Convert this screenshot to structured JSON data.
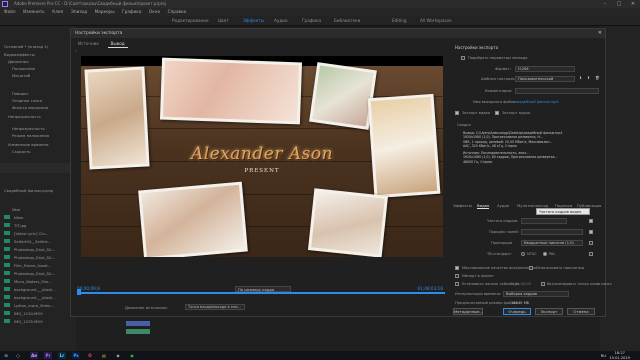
{
  "app": {
    "title": "Adobe Premiere Pro CC - D:\\Сайт\\заказы\\Свадебный фильм\\проект.prproj",
    "menu": [
      "Файл",
      "Изменить",
      "Клип",
      "Эпизод",
      "Маркеры",
      "Графика",
      "Окно",
      "Справка"
    ],
    "workspaces": [
      "Редактирование",
      "Цвет",
      "Эффекты",
      "Аудио",
      "Графика",
      "Библиотеки",
      "Editing",
      "All Workspaces"
    ],
    "active_workspace": "Эффекты"
  },
  "left_panel": {
    "source": "Основной * (эпизод 1)",
    "items": [
      "Видеоэффекты",
      "Движение",
      "Положение",
      "Масштаб",
      "Поворот",
      "Опорная точка",
      "Фильтр мерцания",
      "Непрозрачность",
      "Непрозрачность",
      "Режим наложения",
      "Изменение времени",
      "Скорость"
    ],
    "project_title": "Свадебный фильм.prproj",
    "files": [
      "Имя",
      "titles",
      "TIT.jpg",
      "[Video Lyric] Cin...",
      "Seifert04__Seifert...",
      "Photoshop_Dust_Sti...",
      "Photoshop_Dust_Sti...",
      "Film_Frame_Asset...",
      "Photoshop_Dust_Sti...",
      "Micro_Waters_Sho...",
      "background___black...",
      "background___black...",
      "Lydian_more_Video...",
      "IMG_1234.MOV",
      "IMG_1235.MOV"
    ]
  },
  "dialog": {
    "title": "Настройки экспорта",
    "source_tabs": [
      "Источник",
      "Вывод"
    ],
    "active_source_tab": "Вывод",
    "preview": {
      "title_line": "Alexander  Ason",
      "subtitle": "PRESENT"
    },
    "timecode_in": "00;00;09;8",
    "timecode_out": "01;48;03;16",
    "fit_select": "По размеру кадра",
    "source_range_label": "Диапазон источника:",
    "source_range_value": "Точка входа/выхода в эпи..."
  },
  "settings": {
    "section_title": "Настройки экспорта",
    "match_sequence": "Подобрать параметры эпизода",
    "format_label": "Формат:",
    "format_value": "H.264",
    "preset_label": "Шаблон настроек:",
    "preset_value": "Пользовательский",
    "comments_label": "Комментарии:",
    "output_name_label": "Имя выходного файла:",
    "output_name_value": "свадебный фильм.mp4",
    "export_video": "Экспорт видео",
    "export_audio": "Экспорт аудио",
    "summary_head": "Сводка",
    "summary_output": "Вывод: C:\\Users\\Александр\\Desktop\\свадебный фильм.mp4\n1920x1080 (1,0), Прогрессивная развертка, Н...\nVBR, 1 проход, целевой: 20,00 Мбит/с, Максимальн...\nAAC, 320 Кбит/с, 48 кГц, Стерео",
    "summary_source": "Источник: Последовательность, эпиз...\n1920x1080 (1,0), 60 кадров, Прогрессивная развертка...\n48000 Гц, Стерео",
    "tabs": [
      "Эффекты",
      "Видео",
      "Аудио",
      "Мультиплексор",
      "Подписи",
      "Публикация"
    ],
    "active_tab": "Видео",
    "frame_size_label": "Частота кадров:",
    "field_order_label": "Порядок полей:",
    "aspect_label": "Аспект:",
    "profile_label": "Пропорции",
    "profile_value": "Квадратные пиксели (1,0)",
    "tv_standard_label": "ТВ-стандарт:",
    "ntsc": "NTSC",
    "pal": "PAL",
    "tooltip": "Частота кадров видео",
    "max_render_quality": "Максимальное качество визуализации",
    "use_previews": "Использовать просмотры",
    "import_into_project": "Импорт в проект",
    "set_start_timecode": "Установить начало тайм-кода",
    "start_timecode": "00;00;00;00",
    "render_alpha_only": "Визуализировать только альфа-канал",
    "time_interpolation_label": "Интерполяция времени:",
    "time_interpolation_value": "Выборка кадров",
    "estimated_size_label": "Предполагаемый размер файла:",
    "estimated_size_value": "15840 МБ",
    "buttons": {
      "metadata": "Метаданные...",
      "queue": "Очередь",
      "export": "Экспорт",
      "cancel": "Отмена"
    }
  },
  "taskbar": {
    "lang": "RU",
    "time": "18:27",
    "date": "15.01.2019"
  }
}
